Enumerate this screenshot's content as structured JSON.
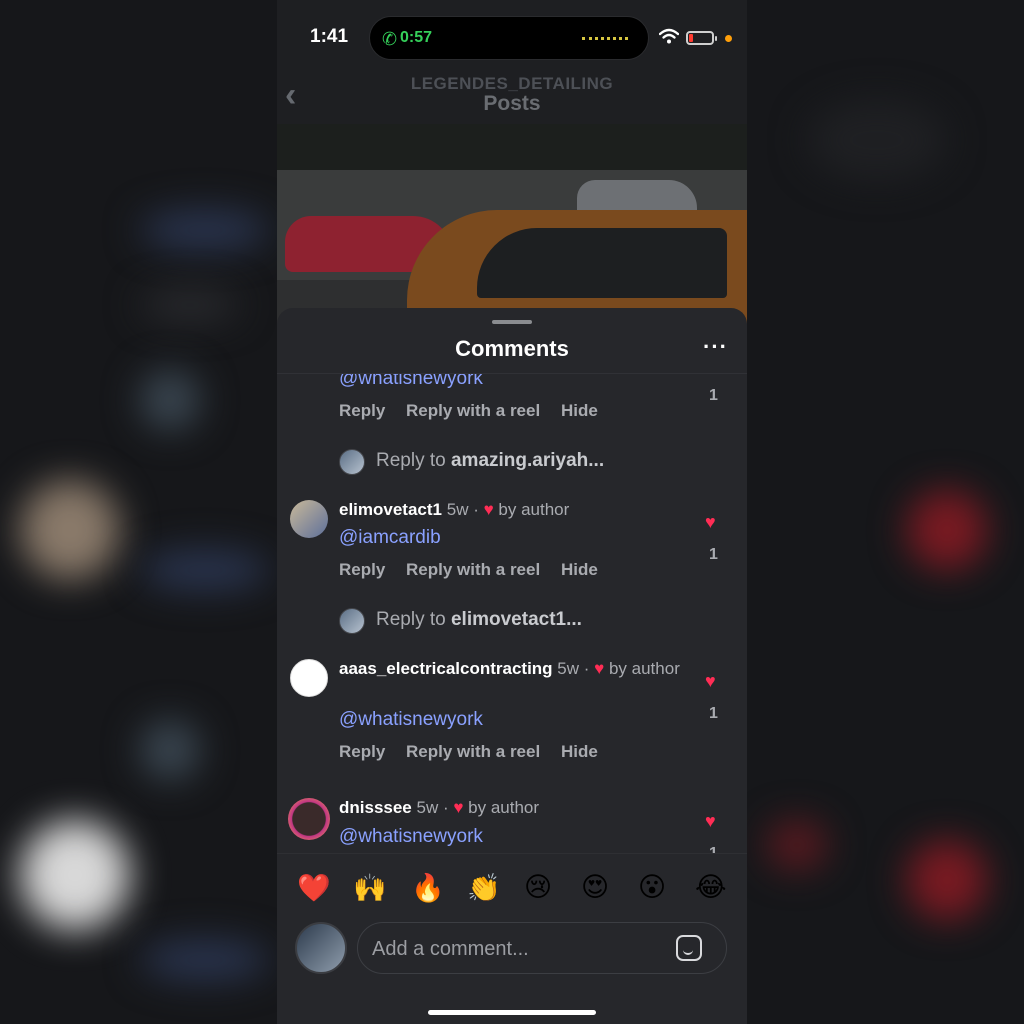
{
  "status": {
    "time": "1:41",
    "call_time": "0:57"
  },
  "nav": {
    "subtitle": "LEGENDES_DETAILING",
    "title": "Posts",
    "back_icon": "chevron-left-icon"
  },
  "sheet": {
    "title": "Comments",
    "more_icon": "ellipsis-icon"
  },
  "comments": [
    {
      "mention": "@whatisnewyork",
      "actions": [
        "Reply",
        "Reply with a reel",
        "Hide"
      ],
      "likes": "1",
      "reply_prefix": "Reply to ",
      "reply_user": "amazing.ariyah..."
    },
    {
      "user": "elimovetact1",
      "age": "5w",
      "liked_by": "by author",
      "mention": "@iamcardib",
      "actions": [
        "Reply",
        "Reply with a reel",
        "Hide"
      ],
      "likes": "1",
      "reply_prefix": "Reply to ",
      "reply_user": "elimovetact1..."
    },
    {
      "user": "aaas_electricalcontracting",
      "age": "5w",
      "liked_by": "by author",
      "mention": "@whatisnewyork",
      "actions": [
        "Reply",
        "Reply with a reel",
        "Hide"
      ],
      "likes": "1"
    },
    {
      "user": "dnisssee",
      "age": "5w",
      "liked_by": "by author",
      "mention": "@whatisnewyork",
      "likes": "1"
    }
  ],
  "reactions": [
    "❤️",
    "🙌",
    "🔥",
    "👏",
    "😢",
    "😍",
    "😮",
    "😂"
  ],
  "compose": {
    "placeholder": "Add a comment...",
    "sticker_icon": "sticker-icon"
  },
  "colors": {
    "mention": "#8aa1ff",
    "heart": "#ff2d55",
    "call_green": "#35d05a"
  }
}
